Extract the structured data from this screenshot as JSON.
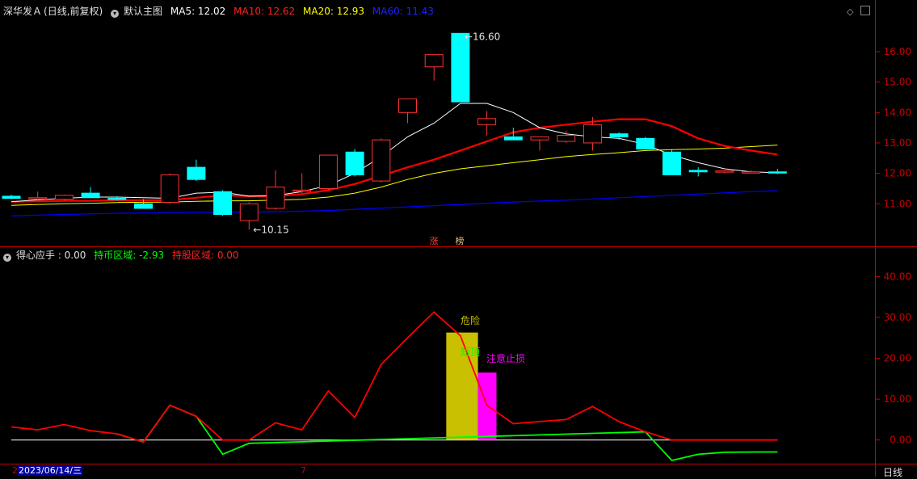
{
  "header": {
    "stock": "深华发Ａ",
    "period": "(日线,前复权)",
    "main_label": "默认主图",
    "ma5_label": "MA5: 12.02",
    "ma10_label": "MA10: 12.62",
    "ma20_label": "MA20: 12.93",
    "ma60_label": "MA60: 11.43"
  },
  "sub_header": {
    "title": "得心应手 : 0.00",
    "hold_coin_label": "持币区域: -2.93",
    "hold_stock_label": "持股区域: 0.00"
  },
  "footer": {
    "date": "2023/06/14/三",
    "left_marker": "2",
    "month_marker": "7",
    "period_tab": "日线"
  },
  "colors": {
    "up": "#ff3232",
    "down": "#00ffff",
    "ma5": "#ffffff",
    "ma10": "#ff0000",
    "ma20": "#ffff00",
    "ma60": "#0000ff",
    "axis": "#cc0000",
    "hold": "#ff0000",
    "coin": "#00ff00",
    "warn_bar": "#c8c000",
    "stop_bar": "#ff00ff"
  },
  "chart_data": [
    {
      "type": "candlestick",
      "title": "",
      "ylim": [
        10.0,
        16.9
      ],
      "y_ticks": [
        "16.00",
        "15.00",
        "14.00",
        "13.00",
        "12.00",
        "11.00"
      ],
      "candles": [
        {
          "o": 11.25,
          "h": 11.3,
          "l": 11.15,
          "c": 11.18
        },
        {
          "o": 11.2,
          "h": 11.4,
          "l": 11.1,
          "c": 11.2
        },
        {
          "o": 11.15,
          "h": 11.3,
          "l": 11.1,
          "c": 11.28
        },
        {
          "o": 11.35,
          "h": 11.55,
          "l": 11.2,
          "c": 11.2
        },
        {
          "o": 11.18,
          "h": 11.25,
          "l": 11.1,
          "c": 11.15
        },
        {
          "o": 11.0,
          "h": 11.15,
          "l": 10.85,
          "c": 10.85
        },
        {
          "o": 11.05,
          "h": 12.0,
          "l": 11.0,
          "c": 11.95
        },
        {
          "o": 12.2,
          "h": 12.45,
          "l": 11.75,
          "c": 11.8
        },
        {
          "o": 11.4,
          "h": 11.45,
          "l": 10.6,
          "c": 10.65
        },
        {
          "o": 10.45,
          "h": 11.05,
          "l": 10.15,
          "c": 11.0
        },
        {
          "o": 10.85,
          "h": 12.1,
          "l": 10.8,
          "c": 11.55
        },
        {
          "o": 11.45,
          "h": 12.0,
          "l": 11.35,
          "c": 11.45
        },
        {
          "o": 11.5,
          "h": 12.6,
          "l": 11.45,
          "c": 12.6
        },
        {
          "o": 12.7,
          "h": 12.8,
          "l": 11.9,
          "c": 11.95
        },
        {
          "o": 11.75,
          "h": 13.15,
          "l": 11.7,
          "c": 13.1
        },
        {
          "o": 14.0,
          "h": 14.45,
          "l": 13.65,
          "c": 14.45
        },
        {
          "o": 15.5,
          "h": 15.9,
          "l": 15.05,
          "c": 15.9
        },
        {
          "o": 16.6,
          "h": 16.6,
          "l": 14.35,
          "c": 14.35
        },
        {
          "o": 13.6,
          "h": 14.05,
          "l": 13.25,
          "c": 13.8
        },
        {
          "o": 13.2,
          "h": 13.5,
          "l": 13.1,
          "c": 13.1
        },
        {
          "o": 13.1,
          "h": 13.2,
          "l": 12.75,
          "c": 13.2
        },
        {
          "o": 13.05,
          "h": 13.4,
          "l": 13.0,
          "c": 13.25
        },
        {
          "o": 13.0,
          "h": 13.85,
          "l": 12.75,
          "c": 13.6
        },
        {
          "o": 13.3,
          "h": 13.35,
          "l": 13.1,
          "c": 13.2
        },
        {
          "o": 13.15,
          "h": 13.2,
          "l": 12.8,
          "c": 12.8
        },
        {
          "o": 12.7,
          "h": 12.8,
          "l": 11.95,
          "c": 11.95
        },
        {
          "o": 12.1,
          "h": 12.2,
          "l": 11.9,
          "c": 12.05
        },
        {
          "o": 12.05,
          "h": 12.1,
          "l": 12.0,
          "c": 12.08
        },
        {
          "o": 12.05,
          "h": 12.1,
          "l": 12.0,
          "c": 12.05
        },
        {
          "o": 12.05,
          "h": 12.15,
          "l": 11.98,
          "c": 12.02
        }
      ],
      "ma5": [
        11.07,
        11.13,
        11.18,
        11.22,
        11.22,
        11.2,
        11.18,
        11.35,
        11.38,
        11.25,
        11.27,
        11.4,
        11.6,
        12.0,
        12.55,
        13.2,
        13.65,
        14.3,
        14.3,
        14.0,
        13.5,
        13.3,
        13.2,
        13.15,
        12.95,
        12.6,
        12.35,
        12.15,
        12.05,
        12.02
      ],
      "ma10": [
        11.07,
        11.08,
        11.1,
        11.1,
        11.12,
        11.12,
        11.12,
        11.2,
        11.28,
        11.25,
        11.25,
        11.32,
        11.45,
        11.65,
        11.92,
        12.2,
        12.45,
        12.75,
        13.05,
        13.35,
        13.5,
        13.6,
        13.7,
        13.78,
        13.78,
        13.55,
        13.15,
        12.9,
        12.75,
        12.62
      ],
      "ma20": [
        10.95,
        10.98,
        11.0,
        11.02,
        11.04,
        11.05,
        11.06,
        11.08,
        11.1,
        11.1,
        11.12,
        11.15,
        11.22,
        11.35,
        11.55,
        11.8,
        12.0,
        12.15,
        12.25,
        12.35,
        12.45,
        12.55,
        12.62,
        12.68,
        12.75,
        12.78,
        12.8,
        12.83,
        12.88,
        12.93
      ],
      "ma60": [
        10.6,
        10.63,
        10.65,
        10.67,
        10.69,
        10.7,
        10.71,
        10.72,
        10.73,
        10.73,
        10.74,
        10.76,
        10.78,
        10.82,
        10.86,
        10.9,
        10.94,
        10.98,
        11.02,
        11.06,
        11.09,
        11.12,
        11.16,
        11.2,
        11.24,
        11.28,
        11.32,
        11.36,
        11.4,
        11.43
      ],
      "annotations": [
        {
          "text": "16.60",
          "index": 17,
          "value": 16.6
        },
        {
          "text": "10.15",
          "index": 9,
          "value": 10.15
        }
      ],
      "markers": [
        "涨",
        "榜"
      ]
    },
    {
      "type": "line",
      "title": "",
      "ylim": [
        -5,
        46
      ],
      "y_ticks": [
        "40.00",
        "30.00",
        "20.00",
        "10.00",
        "0.00"
      ],
      "main_line": [
        3.2,
        2.5,
        3.8,
        2.3,
        1.5,
        -0.5,
        8.5,
        5.8,
        0,
        0,
        4.2,
        2.5,
        12.0,
        5.5,
        18.5,
        25.0,
        31.3,
        25.5,
        8.5,
        4.0,
        4.5,
        5.0,
        8.2,
        4.5,
        2.0,
        0,
        0,
        0,
        0,
        0
      ],
      "coin_line": [
        null,
        null,
        null,
        null,
        1.5,
        -0.5,
        8.5,
        5.8,
        -3.5,
        -0.8,
        null,
        null,
        null,
        null,
        null,
        null,
        null,
        null,
        null,
        null,
        null,
        null,
        null,
        null,
        2.0,
        -5.0,
        -3.5,
        -3.0,
        -2.95,
        -2.93
      ],
      "bars": [
        {
          "index": 16.8,
          "width": 1.2,
          "value": 26.3,
          "color": "warn_bar"
        },
        {
          "index": 18.0,
          "width": 0.7,
          "value": 16.5,
          "color": "stop_bar"
        }
      ],
      "labels": [
        {
          "text": "危险",
          "color": "#c8c000"
        },
        {
          "text": "短顶",
          "color": "#00ff00"
        },
        {
          "text": "注意止损",
          "color": "#ff00ff"
        }
      ]
    }
  ]
}
